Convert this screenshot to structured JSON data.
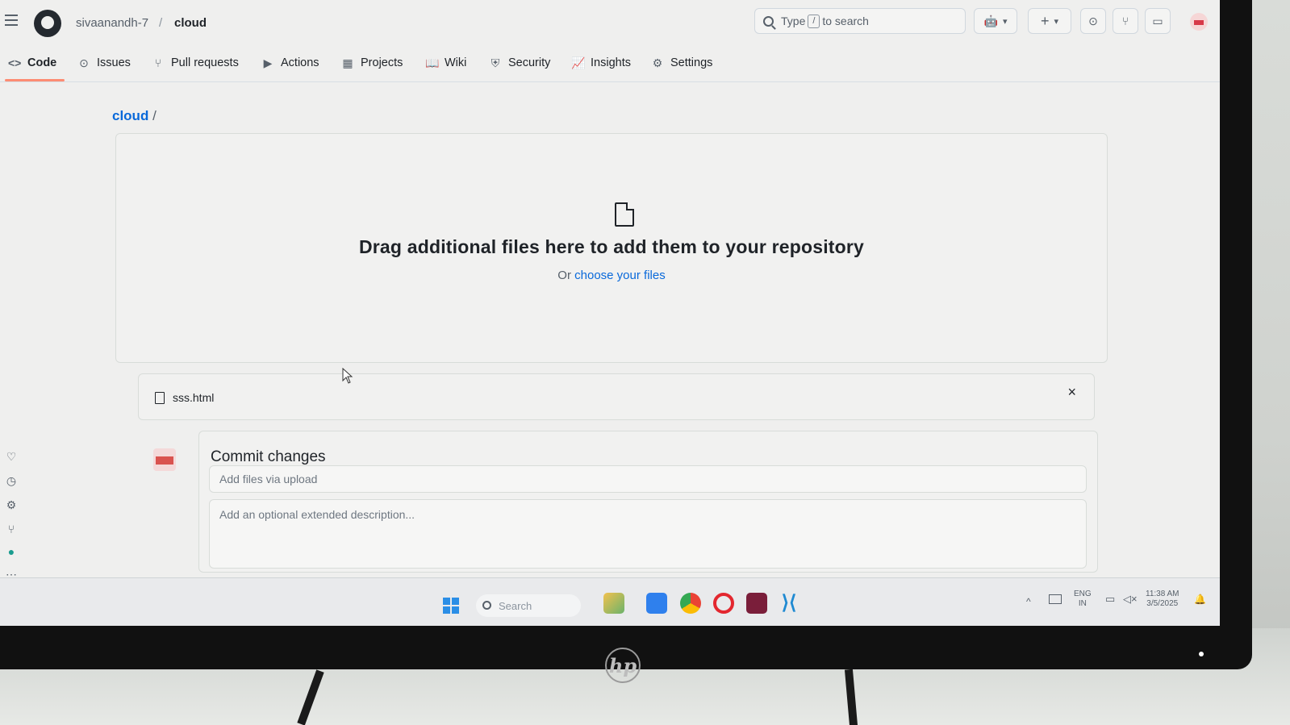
{
  "header": {
    "owner": "sivaanandh-7",
    "separator": "/",
    "repo": "cloud",
    "search_prefix": "Type",
    "search_key": "/",
    "search_suffix": "to search",
    "plus_label": "+",
    "dropdown_caret": "▾"
  },
  "tabs": [
    {
      "label": "Code",
      "icon": "code-icon",
      "glyph": "<>"
    },
    {
      "label": "Issues",
      "icon": "issue-icon",
      "glyph": "⊙"
    },
    {
      "label": "Pull requests",
      "icon": "pull-request-icon",
      "glyph": "⑂"
    },
    {
      "label": "Actions",
      "icon": "play-icon",
      "glyph": "▶"
    },
    {
      "label": "Projects",
      "icon": "table-icon",
      "glyph": "▦"
    },
    {
      "label": "Wiki",
      "icon": "book-icon",
      "glyph": "📖"
    },
    {
      "label": "Security",
      "icon": "shield-icon",
      "glyph": "⛨"
    },
    {
      "label": "Insights",
      "icon": "graph-icon",
      "glyph": "📈"
    },
    {
      "label": "Settings",
      "icon": "gear-icon",
      "glyph": "⚙"
    }
  ],
  "path": {
    "repo": "cloud",
    "slash": "/"
  },
  "dropzone": {
    "title": "Drag additional files here to add them to your repository",
    "sub_prefix": "Or",
    "sub_link": "choose your files"
  },
  "files": [
    {
      "name": "sss.html",
      "remove": "×"
    }
  ],
  "commit": {
    "title": "Commit changes",
    "message_placeholder": "Add files via upload",
    "description_placeholder": "Add an optional extended description..."
  },
  "taskbar": {
    "search_placeholder": "Search",
    "language_line1": "ENG",
    "language_line2": "IN",
    "time": "11:38 AM",
    "date": "3/5/2025"
  },
  "colors": {
    "link": "#0969da",
    "active_tab_underline": "#fd8c73",
    "windows_blue": "#2b8ee6"
  },
  "brand": {
    "monitor_logo": "hp"
  }
}
